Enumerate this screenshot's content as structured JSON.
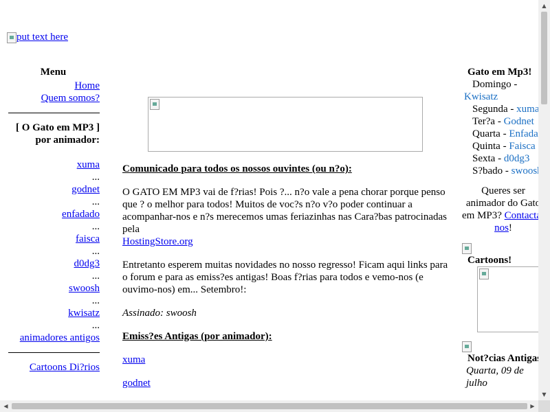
{
  "header": {
    "logo_alt": "put text here"
  },
  "menu": {
    "title": "Menu",
    "links": [
      "Home",
      "Quem somos?"
    ],
    "section_title": "[ O Gato em MP3 ] por animador:",
    "animators": [
      "xuma",
      "godnet",
      "enfadado",
      "faisca",
      "d0dg3",
      "swoosh",
      "kwisatz"
    ],
    "ellipsis": "...",
    "old_animators": "animadores antigos",
    "cartoons_link": "Cartoons Di?rios"
  },
  "main": {
    "announcement_heading": "Comunicado para todos os nossos ouvintes (ou n?o):",
    "para1_text": "O GATO EM MP3 vai de f?rias! Pois ?... n?o vale a pena chorar porque penso que ? o melhor para todos! Muitos de voc?s n?o v?o poder continuar a acompanhar-nos e n?s merecemos umas feriazinhas nas Cara?bas patrocinadas pela",
    "para1_link": "HostingStore.org",
    "para2": "Entretanto esperem muitas novidades no nosso regresso! Ficam aqui links para o forum e para as emiss?es antigas! Boas f?rias para todos e vemo-nos (e ouvimo-nos) em... Setembro!:",
    "signature": "Assinado: swoosh",
    "archive_heading": "Emiss?es Antigas (por animador):",
    "archive_links": [
      "xuma",
      "godnet"
    ]
  },
  "sidebar": {
    "title": "Gato em Mp3!",
    "schedule": [
      {
        "day": "Domingo",
        "host": "Kwisatz"
      },
      {
        "day": "Segunda",
        "host": "xuma"
      },
      {
        "day": "Ter?a",
        "host": "Godnet"
      },
      {
        "day": "Quarta",
        "host": "Enfadado"
      },
      {
        "day": "Quinta",
        "host": "Faisca"
      },
      {
        "day": "Sexta",
        "host": "d0dg3"
      },
      {
        "day": "S?bado",
        "host": "swoosh"
      }
    ],
    "separator": " - ",
    "cta_text": "Queres ser animador do Gato em MP3?",
    "cta_link": "Contacta-nos",
    "cta_end": "!",
    "cartoons_label": "Cartoons!",
    "news_label": "Not?cias Antigas",
    "news_date": "Quarta, 09 de julho"
  },
  "colors": {
    "link": "#0000ee",
    "host_link": "#1a6fc4",
    "scrollbar": "#c1c1c1"
  }
}
